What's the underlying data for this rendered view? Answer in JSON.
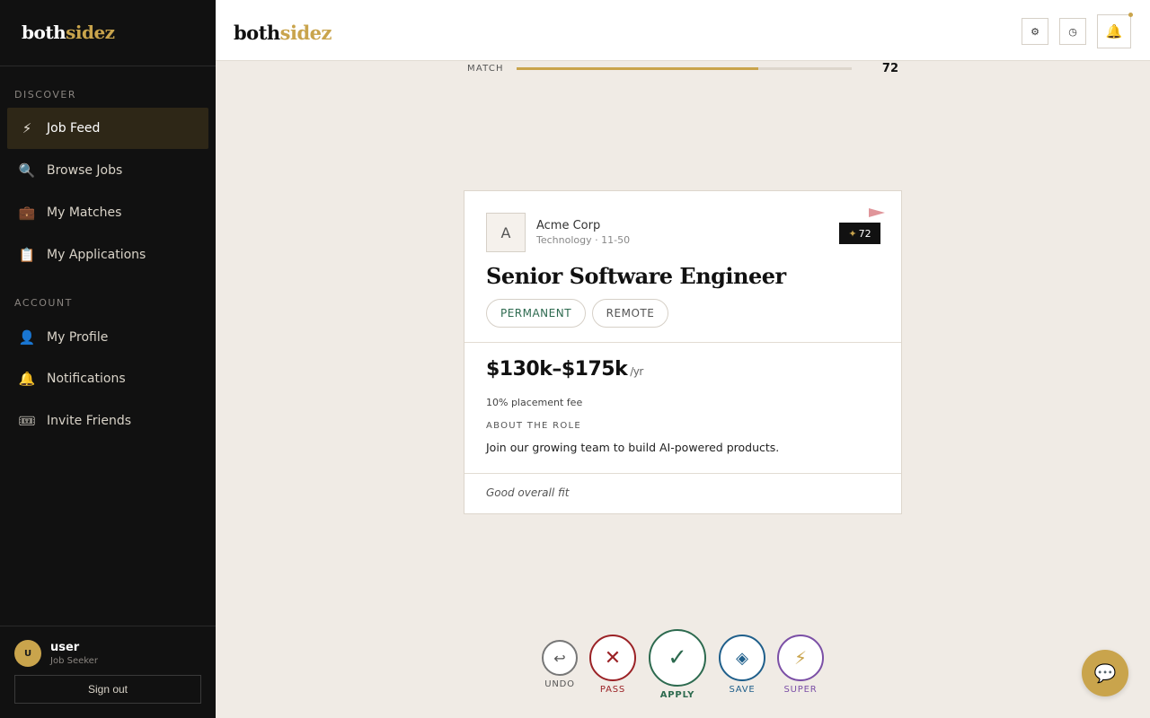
{
  "brand": {
    "part1": "both",
    "part2": "sidez"
  },
  "sidebar": {
    "sections": [
      {
        "label": "DISCOVER"
      },
      {
        "label": "ACCOUNT"
      }
    ],
    "items": [
      {
        "label": "Job Feed",
        "icon": "lightning-icon",
        "glyph": "⚡"
      },
      {
        "label": "Browse Jobs",
        "icon": "search-icon",
        "glyph": "🔍"
      },
      {
        "label": "My Matches",
        "icon": "briefcase-icon",
        "glyph": "💼"
      },
      {
        "label": "My Applications",
        "icon": "clipboard-icon",
        "glyph": "📋"
      },
      {
        "label": "My Profile",
        "icon": "user-icon",
        "glyph": "👤"
      },
      {
        "label": "Notifications",
        "icon": "bell-icon",
        "glyph": "🔔"
      },
      {
        "label": "Invite Friends",
        "icon": "ticket-icon",
        "glyph": "🎟"
      }
    ],
    "user": {
      "initial": "U",
      "name": "user",
      "role": "Job Seeker"
    },
    "signout_label": "Sign out"
  },
  "header": {
    "settings_glyph": "⚙",
    "history_glyph": "◷",
    "bell_glyph": "🔔"
  },
  "match": {
    "label": "MATCH",
    "value": "72",
    "fraction": 0.72
  },
  "job": {
    "company_initial": "A",
    "company": "Acme Corp",
    "company_meta": "Technology · 11-50",
    "score_star": "✦",
    "score": "72",
    "title": "Senior Software Engineer",
    "tags": [
      "PERMANENT",
      "REMOTE"
    ],
    "salary": "$130k–$175k",
    "salary_period": "/yr",
    "fee": "10% placement fee",
    "about_label": "ABOUT THE ROLE",
    "about_text": "Join our growing team to build AI-powered products.",
    "fit": "Good overall fit"
  },
  "actions": {
    "undo": {
      "label": "UNDO",
      "glyph": "↩"
    },
    "pass": {
      "label": "PASS",
      "glyph": "✕"
    },
    "apply": {
      "label": "APPLY",
      "glyph": "✓"
    },
    "save": {
      "label": "SAVE",
      "glyph": "◈"
    },
    "super": {
      "label": "SUPER",
      "glyph": "⚡"
    }
  },
  "chat_glyph": "💬",
  "colors": {
    "accent": "#c9a44c",
    "sidebar_bg": "#111111",
    "content_bg": "#f0ebe5",
    "pass": "#9b2226",
    "apply": "#2d6a4f",
    "save": "#1f5f8b",
    "super": "#7b4fa6"
  }
}
